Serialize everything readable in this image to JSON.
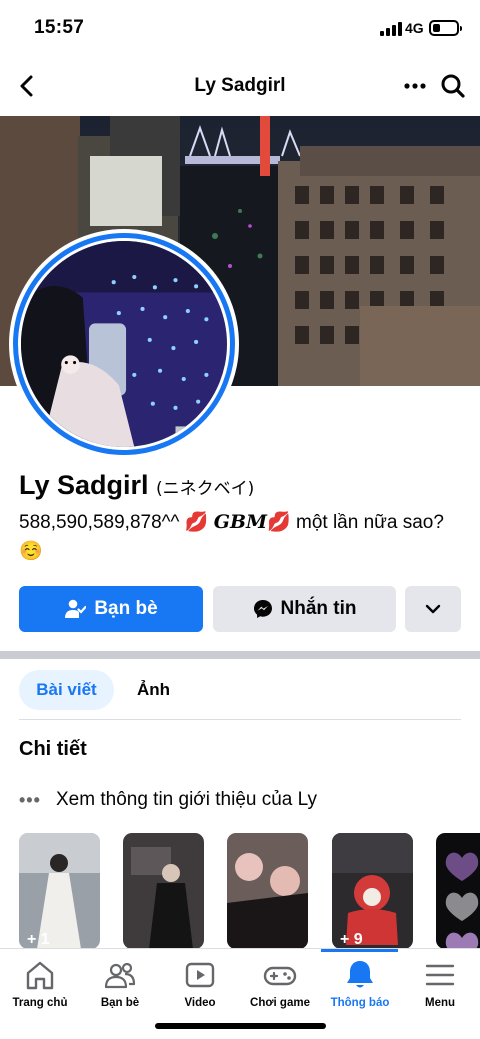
{
  "status_bar": {
    "time": "15:57",
    "network": "4G",
    "battery_level": 0.3
  },
  "header": {
    "title": "Ly Sadgirl"
  },
  "profile": {
    "name": "Ly Sadgirl",
    "alternate_name": "(ニネクベイ)",
    "bio_line1_start": "588,590,589,878^^",
    "bio_emoji_kiss": "💋",
    "bio_gbm": "GBM",
    "bio_line1_end": "một lần nữa",
    "bio_line2": "sao?",
    "bio_emoji_smile": "☺️"
  },
  "actions": {
    "friends_label": "Bạn bè",
    "message_label": "Nhắn tin"
  },
  "tabs": [
    {
      "label": "Bài viết",
      "active": true
    },
    {
      "label": "Ảnh",
      "active": false
    }
  ],
  "details": {
    "title": "Chi tiết",
    "intro_text": "Xem thông tin giới thiệu của Ly"
  },
  "highlights": [
    {
      "count": "+ 1"
    },
    {
      "count": ""
    },
    {
      "count": ""
    },
    {
      "count": "+ 9"
    },
    {
      "count": ""
    }
  ],
  "bottom_nav": [
    {
      "label": "Trang chủ",
      "icon": "home-icon",
      "active": false
    },
    {
      "label": "Bạn bè",
      "icon": "friends-icon",
      "active": false
    },
    {
      "label": "Video",
      "icon": "video-icon",
      "active": false
    },
    {
      "label": "Chơi game",
      "icon": "gamepad-icon",
      "active": false
    },
    {
      "label": "Thông báo",
      "icon": "bell-icon",
      "active": true
    },
    {
      "label": "Menu",
      "icon": "menu-icon",
      "active": false
    }
  ],
  "colors": {
    "accent": "#1877f2",
    "button_gray": "#e4e6eb",
    "tab_active_bg": "#e7f3ff"
  }
}
